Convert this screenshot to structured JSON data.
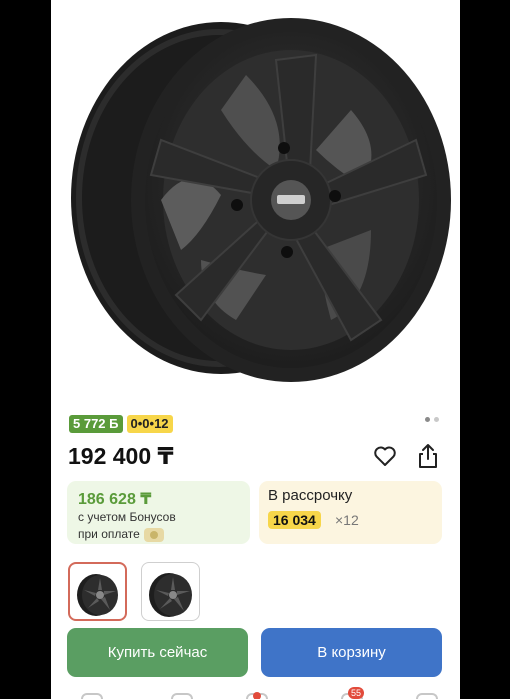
{
  "product": {
    "badge_bonus": "5 772 Б",
    "badge_installment": "0•0•12",
    "price": "192 400 ₸",
    "gallery_dots": 2
  },
  "bonus_card": {
    "amount": "186 628 ₸",
    "line1": "с учетом Бонусов",
    "line2": "при оплате"
  },
  "installment_card": {
    "label": "В рассрочку",
    "monthly": "16 034",
    "multiplier": "×12"
  },
  "buttons": {
    "buy_now": "Купить сейчас",
    "add_to_cart": "В корзину"
  },
  "tabbar": {
    "cart_badge": "55"
  },
  "icons": {
    "favorite": "heart-icon",
    "share": "share-icon"
  },
  "colors": {
    "green": "#5a9b3a",
    "yellow": "#f7d64a",
    "blue_button": "#3f74c8",
    "green_button": "#5a9e62"
  }
}
